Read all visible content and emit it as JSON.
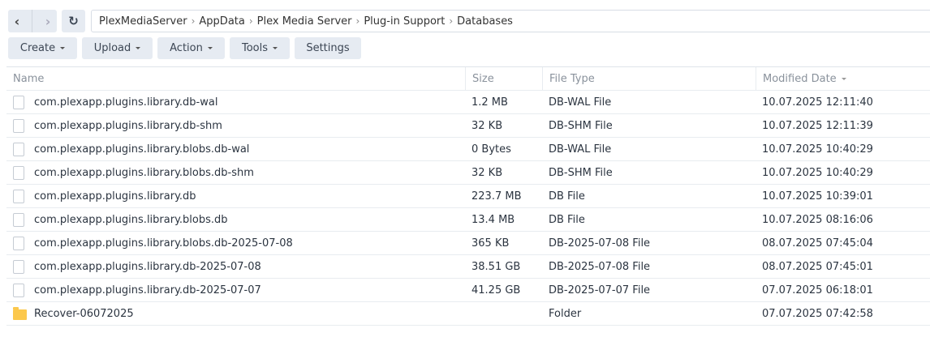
{
  "breadcrumb": [
    "PlexMediaServer",
    "AppData",
    "Plex Media Server",
    "Plug-in Support",
    "Databases"
  ],
  "toolbar": {
    "create": "Create",
    "upload": "Upload",
    "action": "Action",
    "tools": "Tools",
    "settings": "Settings"
  },
  "columns": {
    "name": "Name",
    "size": "Size",
    "type": "File Type",
    "modified": "Modified Date"
  },
  "rows": [
    {
      "name": "com.plexapp.plugins.library.db-wal",
      "size": "1.2 MB",
      "type": "DB-WAL File",
      "modified": "10.07.2025 12:11:40",
      "icon": "file"
    },
    {
      "name": "com.plexapp.plugins.library.db-shm",
      "size": "32 KB",
      "type": "DB-SHM File",
      "modified": "10.07.2025 12:11:39",
      "icon": "file"
    },
    {
      "name": "com.plexapp.plugins.library.blobs.db-wal",
      "size": "0 Bytes",
      "type": "DB-WAL File",
      "modified": "10.07.2025 10:40:29",
      "icon": "file"
    },
    {
      "name": "com.plexapp.plugins.library.blobs.db-shm",
      "size": "32 KB",
      "type": "DB-SHM File",
      "modified": "10.07.2025 10:40:29",
      "icon": "file"
    },
    {
      "name": "com.plexapp.plugins.library.db",
      "size": "223.7 MB",
      "type": "DB File",
      "modified": "10.07.2025 10:39:01",
      "icon": "file"
    },
    {
      "name": "com.plexapp.plugins.library.blobs.db",
      "size": "13.4 MB",
      "type": "DB File",
      "modified": "10.07.2025 08:16:06",
      "icon": "file"
    },
    {
      "name": "com.plexapp.plugins.library.blobs.db-2025-07-08",
      "size": "365 KB",
      "type": "DB-2025-07-08 File",
      "modified": "08.07.2025 07:45:04",
      "icon": "file"
    },
    {
      "name": "com.plexapp.plugins.library.db-2025-07-08",
      "size": "38.51 GB",
      "type": "DB-2025-07-08 File",
      "modified": "08.07.2025 07:45:01",
      "icon": "file"
    },
    {
      "name": "com.plexapp.plugins.library.db-2025-07-07",
      "size": "41.25 GB",
      "type": "DB-2025-07-07 File",
      "modified": "07.07.2025 06:18:01",
      "icon": "file"
    },
    {
      "name": "Recover-06072025",
      "size": "",
      "type": "Folder",
      "modified": "07.07.2025 07:42:58",
      "icon": "folder"
    }
  ]
}
